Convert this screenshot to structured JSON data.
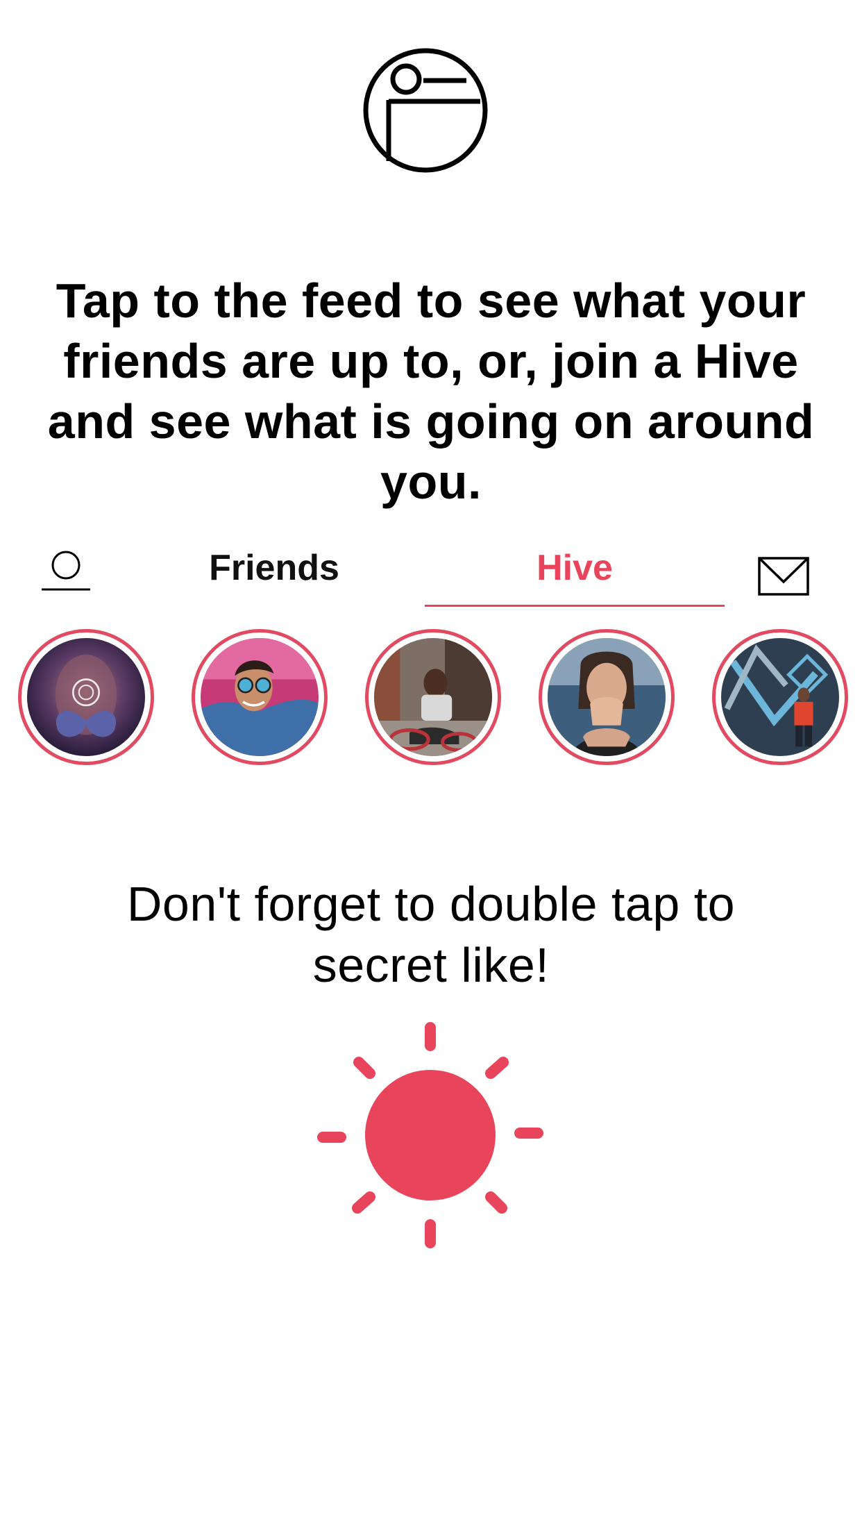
{
  "logo": {
    "icon": "app-logo-icon"
  },
  "intro": {
    "text": "Tap to the feed to see what your friends are up to, or, join a Hive and see what is going on around you."
  },
  "tabs": {
    "profile_icon": "profile-icon",
    "friends_label": "Friends",
    "hive_label": "Hive",
    "active": "Hive",
    "mail_icon": "mail-icon"
  },
  "stories": [
    {
      "name": "story-1"
    },
    {
      "name": "story-2"
    },
    {
      "name": "story-3"
    },
    {
      "name": "story-4"
    },
    {
      "name": "story-5"
    }
  ],
  "tip": {
    "text": "Don't forget to double tap to secret like!"
  },
  "sun": {
    "icon": "sun-icon"
  },
  "colors": {
    "accent": "#E8455C",
    "text": "#000000",
    "background": "#FFFFFF"
  }
}
